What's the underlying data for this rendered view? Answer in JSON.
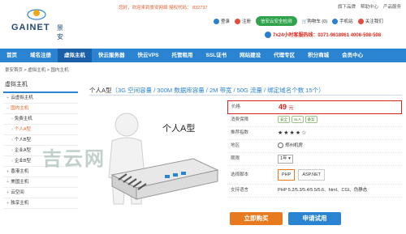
{
  "brand": {
    "logo_text": "GAINET",
    "logo_cn": "景安"
  },
  "top": {
    "greeting": "您好，欢迎来到景安网络",
    "code_label": "授权代码",
    "code": "832737",
    "links": [
      "旗下品牌",
      "帮助中心",
      "产品服务"
    ]
  },
  "userbar": {
    "login": "登录",
    "register": "注册",
    "cert": "信安云安全检测",
    "cart": "购物车 (0)",
    "mobile": "手机站",
    "follow": "关注我们"
  },
  "hotline": "7x24小时客服热线：0371-9618961  4006-598-598",
  "nav": [
    {
      "label": "首页"
    },
    {
      "label": "域名注册"
    },
    {
      "label": "虚拟主机"
    },
    {
      "label": "快云服务器"
    },
    {
      "label": "快云VPS"
    },
    {
      "label": "托管租用"
    },
    {
      "label": "SSL证书"
    },
    {
      "label": "网站建设"
    },
    {
      "label": "代理专区"
    },
    {
      "label": "积分商城"
    },
    {
      "label": "会员中心"
    }
  ],
  "breadcrumb": "景安首页 > 虚拟主机 > 国内主机",
  "sidebar": {
    "title": "虚拟主机",
    "items": [
      {
        "label": "云虚拟主机"
      },
      {
        "label": "国内主机"
      },
      {
        "label": "免费主机"
      },
      {
        "label": "个人A型"
      },
      {
        "label": "个人B型"
      },
      {
        "label": "企业A型"
      },
      {
        "label": "企业B型"
      },
      {
        "label": "香港主机"
      },
      {
        "label": "美国主机"
      },
      {
        "label": "云空间"
      },
      {
        "label": "独享主机"
      }
    ]
  },
  "product": {
    "title": "个人A型",
    "spec": "（3G 空间容量 / 300M 数据库容量 / 2M 带宽 / 50G 流量 / 绑定域名个数 15个）",
    "image_label": "个人A型",
    "watermark": "吉云网"
  },
  "specs": {
    "price_label": "价格",
    "price_value": "49",
    "price_unit": "元",
    "guarantee_label": "消费保障",
    "guarantee_badges": [
      "安全",
      "SLA",
      "备案"
    ],
    "rating_label": "推荐指数",
    "rating": 4.5,
    "region_label": "地区",
    "region_value": "郑州机房",
    "period_label": "期限",
    "period_value": "1年",
    "script_label": "选择脚本",
    "script_options": [
      "PHP",
      "ASP.NET"
    ],
    "support_label": "支持语言",
    "support_value": "PHP 5.2/5.3/5.4/5.5/5.6、html、CGI、伪静态"
  },
  "buttons": {
    "buy": "立即购买",
    "trial": "申请试用"
  },
  "colors": {
    "nav": "#2b84d1",
    "buy": "#e77a1f",
    "price": "#d9231e"
  }
}
